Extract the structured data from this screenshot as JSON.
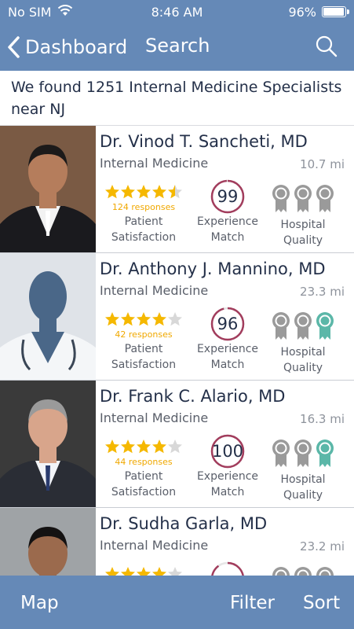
{
  "status_bar": {
    "carrier": "No SIM",
    "time": "8:46 AM",
    "battery": "96%"
  },
  "nav": {
    "back_label": "Dashboard",
    "title": "Search"
  },
  "summary": "We found 1251 Internal Medicine Specialists near NJ",
  "labels": {
    "satisfaction_line1": "Patient",
    "satisfaction_line2": "Satisfaction",
    "experience_line1": "Experience",
    "experience_line2": "Match",
    "hospital_line1": "Hospital",
    "hospital_line2": "Quality"
  },
  "colors": {
    "bar": "#6589b7",
    "star": "#f5b800",
    "ring": "#a23d5d",
    "ribbon_gray": "#9a9a9a",
    "ribbon_teal": "#5bb7a8"
  },
  "doctors": [
    {
      "name": "Dr. Vinod T. Sancheti, MD",
      "specialty": "Internal Medicine",
      "distance": "10.7 mi",
      "rating": 4.5,
      "responses": "124 responses",
      "experience": "99",
      "experience_fill": 0.99,
      "hospital": [
        "gray",
        "gray",
        "gray"
      ],
      "photo": "photo"
    },
    {
      "name": "Dr. Anthony J. Mannino, MD",
      "specialty": "Internal Medicine",
      "distance": "23.3 mi",
      "rating": 4,
      "responses": "42 responses",
      "experience": "96",
      "experience_fill": 0.96,
      "hospital": [
        "gray",
        "gray",
        "teal"
      ],
      "photo": "silhouette"
    },
    {
      "name": "Dr. Frank C. Alario, MD",
      "specialty": "Internal Medicine",
      "distance": "16.3 mi",
      "rating": 4,
      "responses": "44 responses",
      "experience": "100",
      "experience_fill": 1.0,
      "hospital": [
        "gray",
        "gray",
        "teal"
      ],
      "photo": "photo"
    },
    {
      "name": "Dr. Sudha Garla, MD",
      "specialty": "Internal Medicine",
      "distance": "23.2 mi",
      "rating": 4,
      "responses": "",
      "experience": "",
      "experience_fill": 0.9,
      "hospital": [
        "gray",
        "gray",
        "gray"
      ],
      "photo": "photo"
    }
  ],
  "bottom_bar": {
    "map": "Map",
    "filter": "Filter",
    "sort": "Sort"
  }
}
